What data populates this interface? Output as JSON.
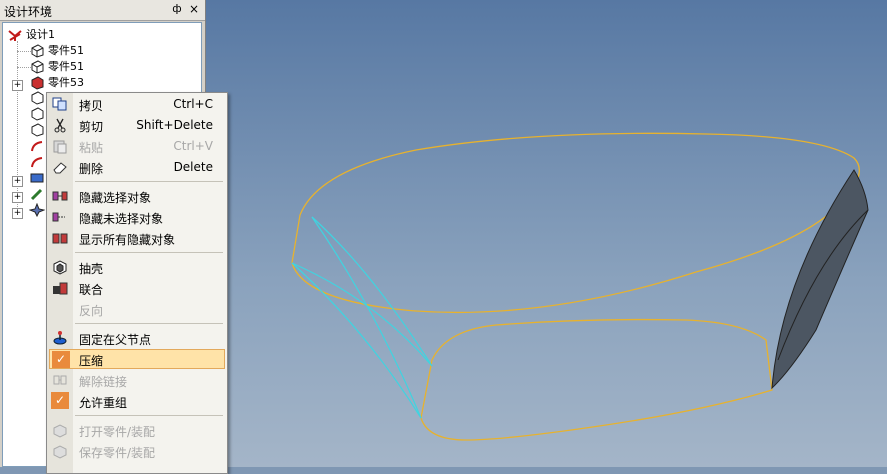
{
  "panel": {
    "title": "设计环境",
    "pin_glyph": "ф",
    "close_glyph": "×"
  },
  "tree": {
    "root": "设计1",
    "items": [
      "零件51",
      "零件51",
      "零件53"
    ]
  },
  "menu": {
    "copy": {
      "label": "拷贝",
      "shortcut": "Ctrl+C"
    },
    "cut": {
      "label": "剪切",
      "shortcut": "Shift+Delete"
    },
    "paste": {
      "label": "粘贴",
      "shortcut": "Ctrl+V"
    },
    "delete": {
      "label": "删除",
      "shortcut": "Delete"
    },
    "hide_selected": {
      "label": "隐藏选择对象"
    },
    "hide_unselected": {
      "label": "隐藏未选择对象"
    },
    "show_all": {
      "label": "显示所有隐藏对象"
    },
    "shell": {
      "label": "抽壳"
    },
    "union": {
      "label": "联合"
    },
    "reverse": {
      "label": "反向"
    },
    "fix_parent": {
      "label": "固定在父节点"
    },
    "suppress": {
      "label": "压缩"
    },
    "remove_link": {
      "label": "解除链接"
    },
    "allow_regroup": {
      "label": "允许重组"
    },
    "open_part": {
      "label": "打开零件/装配"
    },
    "save_part": {
      "label": "保存零件/装配"
    }
  },
  "colors": {
    "outline": "#e7b22e",
    "edge": "#3fd4e0",
    "face": "#4c5662",
    "highlight": "#ffe3a8",
    "check": "#e98a3c"
  }
}
